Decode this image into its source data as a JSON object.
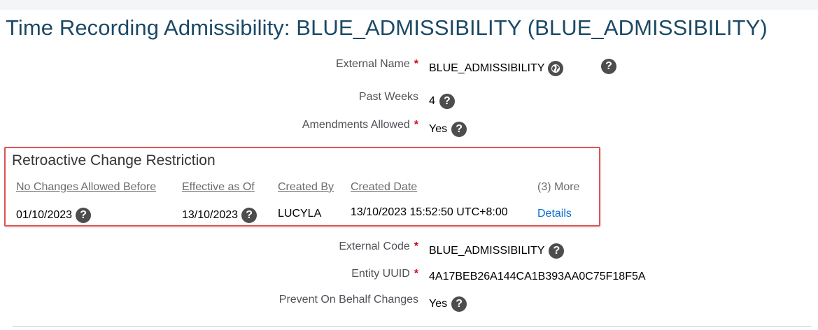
{
  "title": "Time Recording Admissibility: BLUE_ADMISSIBILITY (BLUE_ADMISSIBILITY)",
  "fields": {
    "external_name": {
      "label": "External Name",
      "required": "*",
      "value": "BLUE_ADMISSIBILITY"
    },
    "past_weeks": {
      "label": "Past Weeks",
      "value": "4"
    },
    "amendments_allowed": {
      "label": "Amendments Allowed",
      "required": "*",
      "value": "Yes"
    },
    "external_code": {
      "label": "External Code",
      "required": "*",
      "value": "BLUE_ADMISSIBILITY"
    },
    "entity_uuid": {
      "label": "Entity UUID",
      "required": "*",
      "value": "4A17BEB26A144CA1B393AA0C75F18F5A"
    },
    "prevent_on_behalf": {
      "label": "Prevent On Behalf Changes",
      "value": "Yes"
    }
  },
  "retro_panel": {
    "title": "Retroactive Change Restriction",
    "columns": [
      "No Changes Allowed Before",
      "Effective as Of",
      "Created By",
      "Created Date",
      "(3) More"
    ],
    "row": {
      "no_changes_before": "01/10/2023",
      "effective_as_of": "13/10/2023",
      "created_by": "LUCYLA",
      "created_date": "13/10/2023 15:52:50 UTC+8:00",
      "details_link": "Details"
    }
  },
  "icons": {
    "help": "?",
    "globe": "globe-icon"
  },
  "colors": {
    "title": "#1b4966",
    "required": "#d0021b",
    "link": "#0a6ed1",
    "highlight_border": "#e05353"
  }
}
